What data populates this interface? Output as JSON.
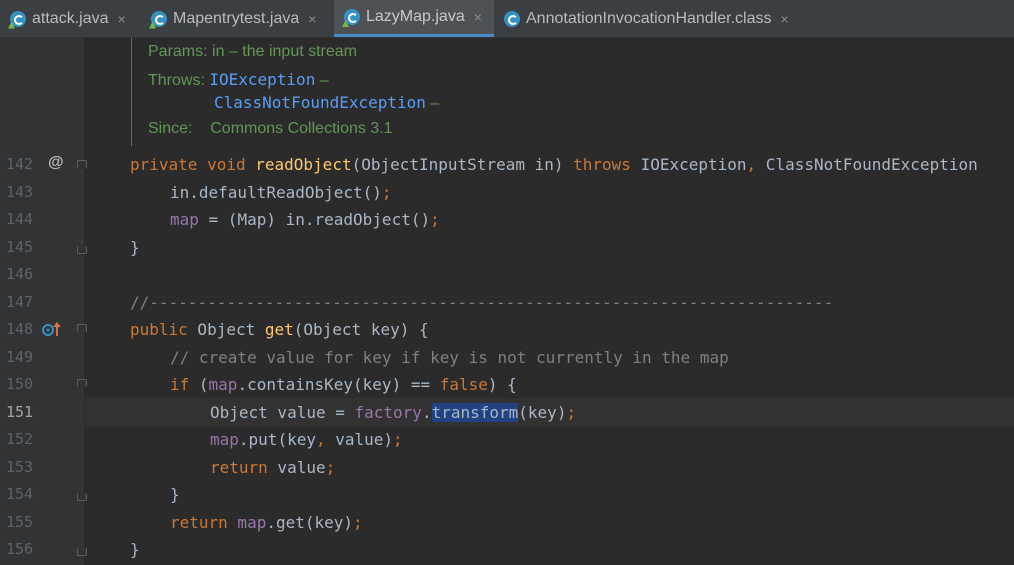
{
  "tabs": [
    {
      "label": "attack.java",
      "active": false
    },
    {
      "label": "Mapentrytest.java",
      "active": false
    },
    {
      "label": "LazyMap.java",
      "active": true
    },
    {
      "label": "AnnotationInvocationHandler.class",
      "active": false
    }
  ],
  "tab_close_glyph": "×",
  "doc": {
    "params_label": "Params:",
    "params_value": "in – the input stream",
    "throws_label": "Throws:",
    "throws_1": "IOException",
    "throws_2": "ClassNotFoundException",
    "dash": "–",
    "since_label": "Since:",
    "since_value": "Commons Collections 3.1"
  },
  "gutter": {
    "line_numbers": [
      "142",
      "143",
      "144",
      "145",
      "146",
      "147",
      "148",
      "149",
      "150",
      "151",
      "152",
      "153",
      "154",
      "155",
      "156"
    ],
    "current_line": "151",
    "annotation_glyph": "@"
  },
  "code": {
    "l142": {
      "kw1": "private",
      "kw2": "void",
      "fn": "readObject",
      "p1": "(ObjectInputStream in) ",
      "kw3": "throws",
      "p2": " IOException",
      "comma": ",",
      "p3": " ClassNotFoundException"
    },
    "l143": {
      "t": "in.defaultReadObject()",
      "semi": ";"
    },
    "l144": {
      "fld": "map",
      "t": " = (Map) in.readObject()",
      "semi": ";"
    },
    "l145": {
      "t": "}"
    },
    "l147": {
      "cm": "//-----------------------------------------------------------------------"
    },
    "l148": {
      "kw": "public",
      "p1": " Object ",
      "fn": "get",
      "p2": "(Object key) {"
    },
    "l149": {
      "cm": "// create value for key if key is not currently in the map"
    },
    "l150": {
      "kw": "if",
      "p1": " (",
      "fld": "map",
      "p2": ".containsKey(key) == ",
      "kw2": "false",
      "p3": ") {"
    },
    "l151": {
      "p1": "Object value = ",
      "fld": "factory",
      "p2": ".",
      "sel": "transform",
      "p3": "(key)",
      "semi": ";"
    },
    "l152": {
      "fld": "map",
      "p1": ".put(key",
      "comma": ",",
      "p2": " value)",
      "semi": ";"
    },
    "l153": {
      "kw": "return",
      "p1": " value",
      "semi": ";"
    },
    "l154": {
      "t": "}"
    },
    "l155": {
      "kw": "return",
      "fld": " map",
      "p1": ".get(key)",
      "semi": ";"
    },
    "l156": {
      "t": "}"
    }
  },
  "colors": {
    "background": "#2b2b2b",
    "keyword": "#cc7832",
    "function": "#ffc66d",
    "field": "#9876aa",
    "comment": "#808080",
    "doc": "#629755",
    "link": "#589df6",
    "selection": "#214283",
    "active_tab_underline": "#4a88c7"
  },
  "icons": [
    "java-class-icon",
    "close-icon",
    "annotation-icon",
    "override-icon",
    "fold-icon"
  ]
}
